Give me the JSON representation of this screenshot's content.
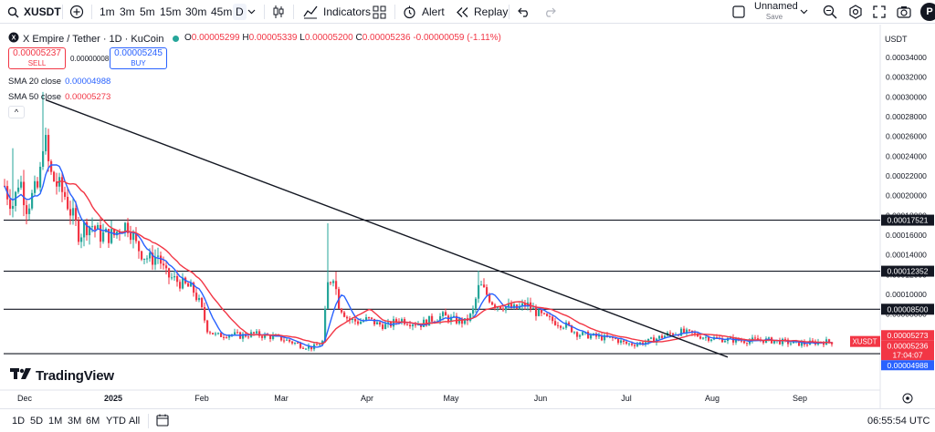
{
  "toolbar": {
    "symbol": "XUSDT",
    "intervals": [
      "1m",
      "3m",
      "5m",
      "15m",
      "30m",
      "45m",
      "D"
    ],
    "active_interval": "D",
    "indicators_label": "Indicators",
    "alert_label": "Alert",
    "replay_label": "Replay",
    "layout_name": "Unnamed",
    "layout_status": "Save",
    "profile_initial": "P"
  },
  "legend": {
    "title": "X Empire / Tether · 1D · KuCoin",
    "open_label": "O",
    "open": "0.00005299",
    "high_label": "H",
    "high": "0.00005339",
    "low_label": "L",
    "low": "0.00005200",
    "close_label": "C",
    "close": "0.00005236",
    "change": "-0.00000059 (-1.11%)",
    "sell_price": "0.00005237",
    "sell_label": "SELL",
    "buy_price": "0.00005245",
    "buy_label": "BUY",
    "spread": "0.00000008",
    "sma20_label": "SMA 20 close",
    "sma20_value": "0.00004988",
    "sma50_label": "SMA 50 close",
    "sma50_value": "0.00005273",
    "collapse_glyph": "^"
  },
  "axis": {
    "currency": "USDT",
    "y_ticks": [
      "0.00034000",
      "0.00032000",
      "0.00030000",
      "0.00028000",
      "0.00026000",
      "0.00024000",
      "0.00022000",
      "0.00020000",
      "0.00018000",
      "0.00016000",
      "0.00014000",
      "0.00012000",
      "0.00010000",
      "0.00008000",
      "0.00006000",
      "0.00004000"
    ],
    "x_ticks": [
      "Dec",
      "2025",
      "Feb",
      "Mar",
      "Apr",
      "May",
      "Jun",
      "Jul",
      "Aug",
      "Sep"
    ],
    "levels": [
      "0.00017521",
      "0.00012352",
      "0.00008500",
      "0.00004000"
    ],
    "price_tag_symbol": "XUSDT",
    "sma50_tag": "0.00005273",
    "close_tag": "0.00005236",
    "countdown": "17:04:07",
    "sma20_tag": "0.00004988"
  },
  "bottom": {
    "ranges": [
      "1D",
      "5D",
      "1M",
      "3M",
      "6M",
      "YTD",
      "All"
    ],
    "time": "06:55:54 UTC"
  },
  "branding": {
    "logo_text": "TradingView"
  },
  "colors": {
    "up": "#26a69a",
    "down": "#f23645",
    "sma20": "#2962ff",
    "sma50": "#f23645",
    "level": "#131722"
  }
}
